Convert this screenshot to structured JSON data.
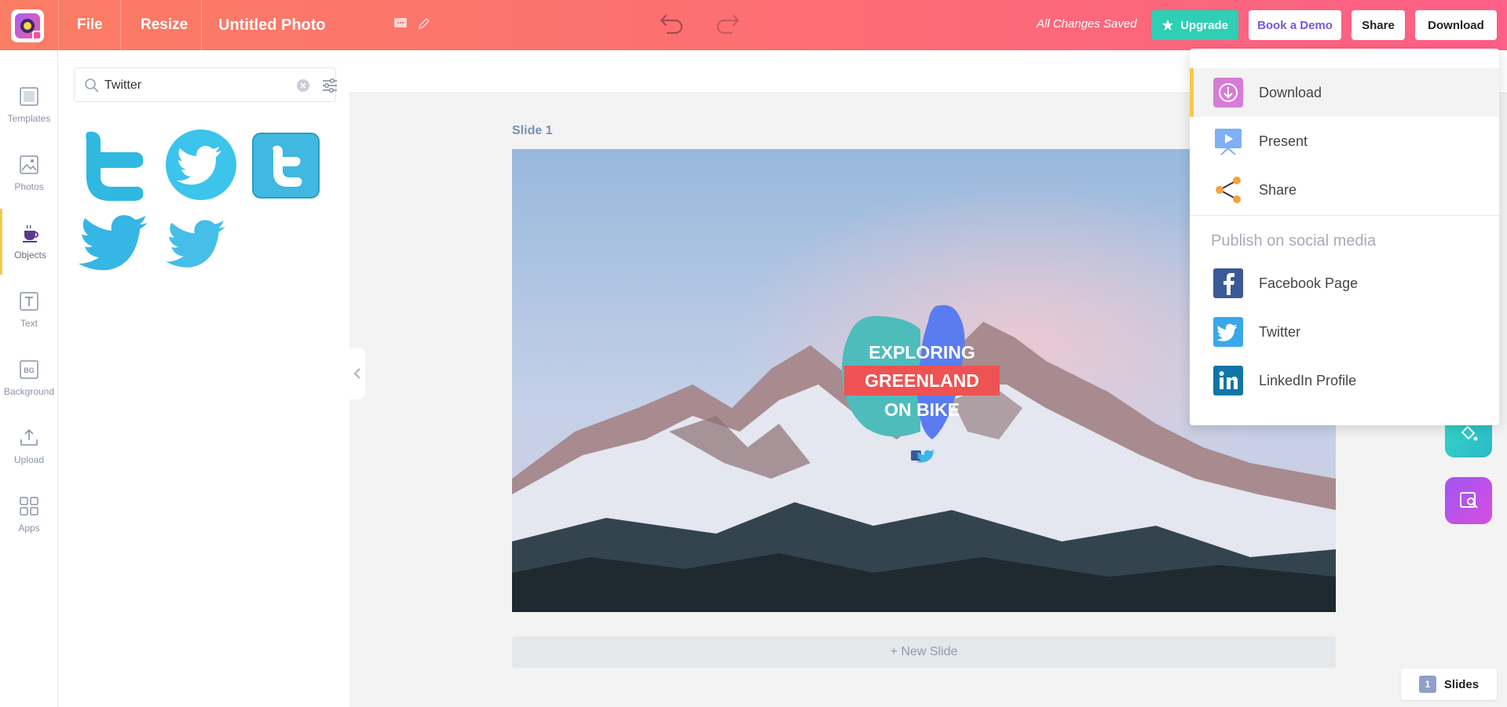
{
  "header": {
    "file_label": "File",
    "resize_label": "Resize",
    "document_title": "Untitled Photo",
    "saved_status": "All Changes Saved",
    "upgrade_label": "Upgrade",
    "demo_label": "Book a Demo",
    "share_label": "Share",
    "download_label": "Download"
  },
  "sidebar": {
    "items": [
      {
        "label": "Templates",
        "icon": "templates-icon"
      },
      {
        "label": "Photos",
        "icon": "photos-icon"
      },
      {
        "label": "Objects",
        "icon": "objects-icon"
      },
      {
        "label": "Text",
        "icon": "text-icon"
      },
      {
        "label": "Background",
        "icon": "background-icon"
      },
      {
        "label": "Upload",
        "icon": "upload-icon"
      },
      {
        "label": "Apps",
        "icon": "apps-icon"
      }
    ],
    "active": "Objects"
  },
  "search": {
    "value": "Twitter"
  },
  "slide": {
    "label": "Slide 1",
    "headline_lines": [
      "EXPLORING",
      "GREENLAND",
      "ON BIKE"
    ]
  },
  "new_slide_label": "+ New Slide",
  "slides_button": {
    "count": "1",
    "label": "Slides"
  },
  "download_menu": {
    "items": [
      {
        "label": "Download",
        "icon": "download-icon"
      },
      {
        "label": "Present",
        "icon": "present-icon"
      },
      {
        "label": "Share",
        "icon": "share-icon"
      }
    ],
    "social_heading": "Publish on social media",
    "social_items": [
      {
        "label": "Facebook Page",
        "icon": "facebook-icon"
      },
      {
        "label": "Twitter",
        "icon": "twitter-icon"
      },
      {
        "label": "LinkedIn Profile",
        "icon": "linkedin-icon"
      }
    ]
  },
  "colors": {
    "topbar_start": "#fb7d63",
    "topbar_end": "#fd5f86",
    "upgrade": "#2ecfb4",
    "demo_text": "#7b54d9",
    "active_marker": "#f6c94a"
  }
}
